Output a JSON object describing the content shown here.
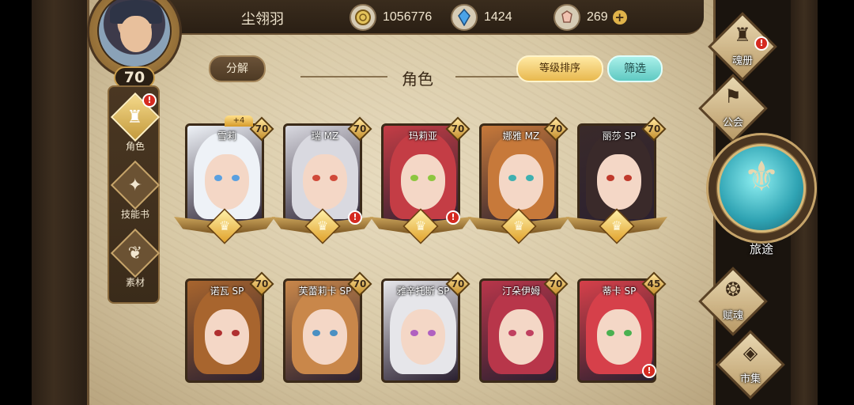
{
  "player": {
    "name": "尘翎羽",
    "level": "70"
  },
  "currencies": [
    {
      "icon": "gold-coin-icon",
      "value": "1056776"
    },
    {
      "icon": "blue-crystal-icon",
      "value": "1424"
    },
    {
      "icon": "pink-gem-icon",
      "value": "269"
    }
  ],
  "header": {
    "decompose_label": "分解",
    "title": "角色",
    "sort_label": "等级排序",
    "filter_label": "筛选"
  },
  "left_nav": [
    {
      "icon": "helmet-icon",
      "label": "角色",
      "active": true,
      "alert": true
    },
    {
      "icon": "skill-book-icon",
      "label": "技能书",
      "active": false,
      "alert": false
    },
    {
      "icon": "material-icon",
      "label": "素材",
      "active": false,
      "alert": false
    }
  ],
  "right_menu": {
    "soul_book": "魂册",
    "guild": "公会",
    "journey": "旅途",
    "soul_gift": "赋魂",
    "market": "市集"
  },
  "characters": [
    {
      "name": "雪莉",
      "level": "70",
      "plus": "+4",
      "hair": "#eef2f7",
      "eye": "#5aa0e0",
      "alert": false
    },
    {
      "name": "瑞 MZ",
      "level": "70",
      "plus": "",
      "hair": "#d9d9e0",
      "eye": "#d04a3a",
      "alert": true
    },
    {
      "name": "玛莉亚",
      "level": "70",
      "plus": "",
      "hair": "#c43d45",
      "eye": "#8dc63f",
      "alert": true
    },
    {
      "name": "娜雅 MZ",
      "level": "70",
      "plus": "",
      "hair": "#c7793a",
      "eye": "#3fb0b0",
      "alert": false
    },
    {
      "name": "丽莎 SP",
      "level": "70",
      "plus": "",
      "hair": "#3a2a2a",
      "eye": "#c0392b",
      "alert": false
    },
    {
      "name": "诺瓦 SP",
      "level": "70",
      "plus": "",
      "hair": "#a8652e",
      "eye": "#b03030",
      "alert": false
    },
    {
      "name": "芙蕾莉卡 SP",
      "level": "70",
      "plus": "",
      "hair": "#c9874a",
      "eye": "#4a90c2",
      "alert": false
    },
    {
      "name": "雅辛托斯 SP",
      "level": "70",
      "plus": "",
      "hair": "#e6e6ea",
      "eye": "#b060c0",
      "alert": false
    },
    {
      "name": "汀朵伊姆",
      "level": "70",
      "plus": "",
      "hair": "#b8364a",
      "eye": "#c04060",
      "alert": false
    },
    {
      "name": "蒂卡 SP",
      "level": "45",
      "plus": "",
      "hair": "#d6404a",
      "eye": "#4ab050",
      "alert": true
    }
  ]
}
